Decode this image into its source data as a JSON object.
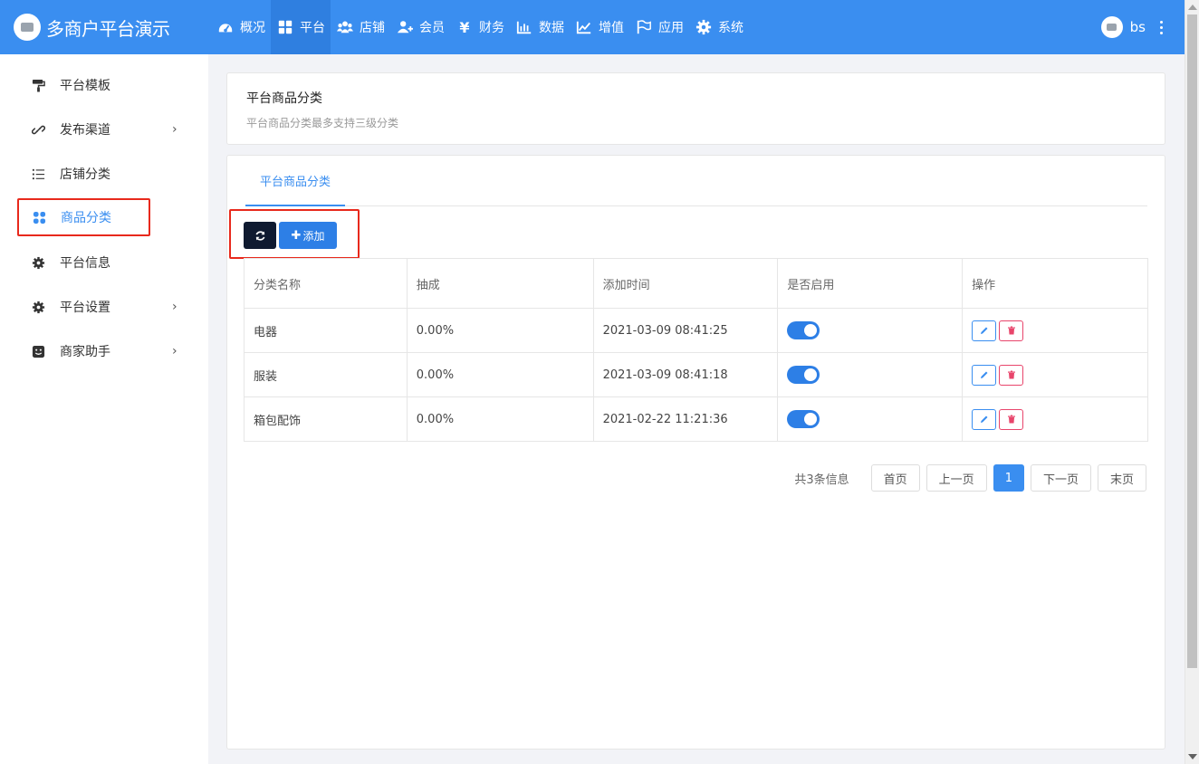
{
  "brand": {
    "title": "多商户平台演示"
  },
  "nav": [
    {
      "label": "概况",
      "icon": "dashboard-icon",
      "active": false
    },
    {
      "label": "平台",
      "icon": "grid-icon",
      "active": true
    },
    {
      "label": "店铺",
      "icon": "users-icon",
      "active": false
    },
    {
      "label": "会员",
      "icon": "user-plus-icon",
      "active": false
    },
    {
      "label": "财务",
      "icon": "yen-icon",
      "active": false
    },
    {
      "label": "数据",
      "icon": "bar-chart-icon",
      "active": false
    },
    {
      "label": "增值",
      "icon": "line-chart-icon",
      "active": false
    },
    {
      "label": "应用",
      "icon": "flag-icon",
      "active": false
    },
    {
      "label": "系统",
      "icon": "gear-icon",
      "active": false
    }
  ],
  "user": {
    "name": "bs"
  },
  "sidebar": {
    "items": [
      {
        "label": "平台模板",
        "icon": "paint-roller-icon",
        "has_submenu": false
      },
      {
        "label": "发布渠道",
        "icon": "link-icon",
        "has_submenu": true
      },
      {
        "label": "店铺分类",
        "icon": "list-icon",
        "has_submenu": false
      },
      {
        "label": "商品分类",
        "icon": "apps-icon",
        "has_submenu": false,
        "active": true
      },
      {
        "label": "平台信息",
        "icon": "gear-icon",
        "has_submenu": false
      },
      {
        "label": "平台设置",
        "icon": "gear-icon",
        "has_submenu": true
      },
      {
        "label": "商家助手",
        "icon": "smile-icon",
        "has_submenu": true
      }
    ]
  },
  "header_card": {
    "title": "平台商品分类",
    "subtitle": "平台商品分类最多支持三级分类"
  },
  "tabs": [
    {
      "label": "平台商品分类",
      "active": true
    }
  ],
  "toolbar": {
    "add_label": "添加"
  },
  "table": {
    "columns": [
      "分类名称",
      "抽成",
      "添加时间",
      "是否启用",
      "操作"
    ],
    "rows": [
      {
        "name": "电器",
        "commission": "0.00%",
        "added_at": "2021-03-09 08:41:25",
        "enabled": true
      },
      {
        "name": "服装",
        "commission": "0.00%",
        "added_at": "2021-03-09 08:41:18",
        "enabled": true
      },
      {
        "name": "箱包配饰",
        "commission": "0.00%",
        "added_at": "2021-02-22 11:21:36",
        "enabled": true
      }
    ]
  },
  "pagination": {
    "total_text": "共3条信息",
    "first": "首页",
    "prev": "上一页",
    "current": "1",
    "next": "下一页",
    "last": "末页"
  },
  "colors": {
    "primary": "#3a8ef0",
    "highlight": "#e8291c",
    "danger": "#e8456b",
    "dark": "#0f1a30"
  }
}
